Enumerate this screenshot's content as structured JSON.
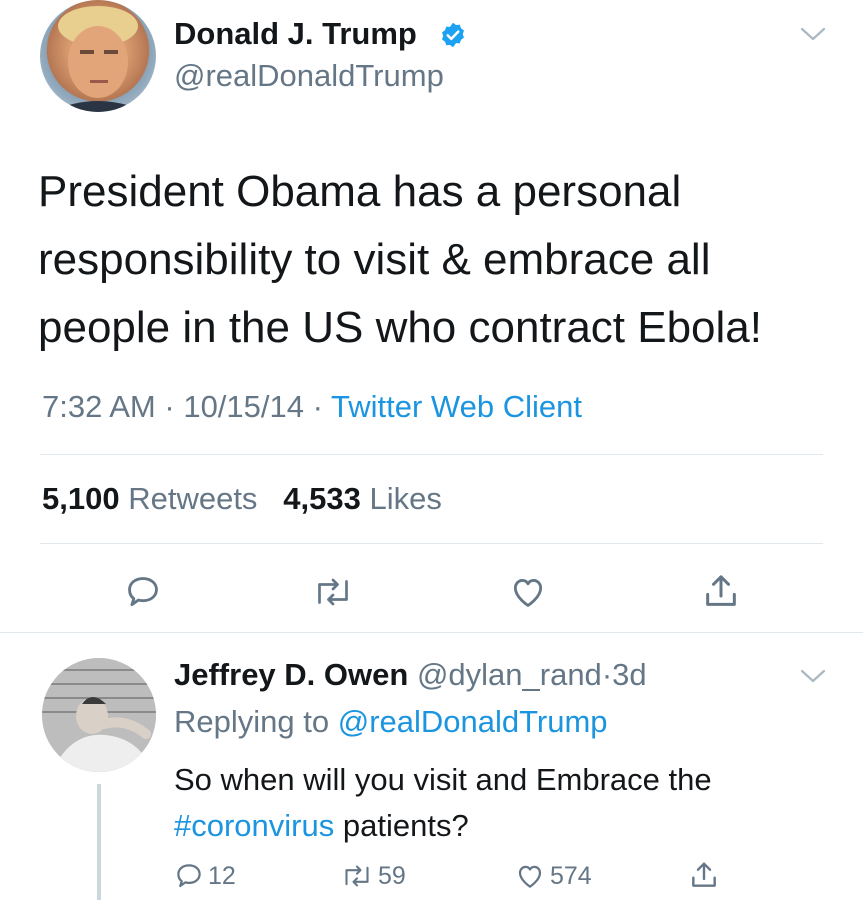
{
  "tweet": {
    "author_name": "Donald J. Trump",
    "handle": "@realDonaldTrump",
    "text": "President Obama has a personal responsibility to visit & embrace all people in the US who contract Ebola!",
    "time": "7:32 AM",
    "date": "10/15/14",
    "source": "Twitter Web Client",
    "separator": "·",
    "retweets_count": "5,100",
    "retweets_label": "Retweets",
    "likes_count": "4,533",
    "likes_label": "Likes"
  },
  "reply": {
    "author_name": "Jeffrey D. Owen",
    "handle": "@dylan_rand",
    "age": "3d",
    "separator": "·",
    "replying_prefix": "Replying to",
    "replying_handle": "@realDonaldTrump",
    "text_before": "So when will you visit and Embrace the",
    "hashtag": "#coronvirus",
    "text_after": " patients?",
    "reply_count": "12",
    "retweet_count": "59",
    "like_count": "574"
  },
  "colors": {
    "accent": "#1b95e0",
    "muted": "#657786",
    "verified": "#1da1f2",
    "divider": "#e1e8ed"
  },
  "icons": [
    "verified-badge-icon",
    "chevron-down-icon",
    "reply-icon",
    "retweet-icon",
    "like-icon",
    "share-icon"
  ]
}
